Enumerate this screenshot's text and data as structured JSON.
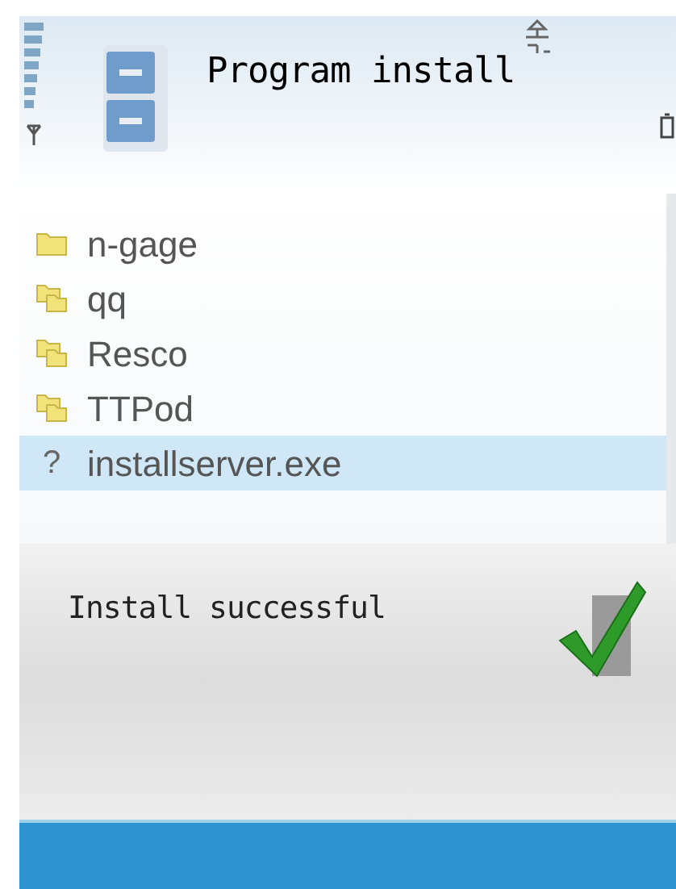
{
  "title": "Program install",
  "items": [
    {
      "name": "n-gage",
      "kind": "folder",
      "selected": false
    },
    {
      "name": "qq",
      "kind": "folder-group",
      "selected": false
    },
    {
      "name": "Resco",
      "kind": "folder-group",
      "selected": false
    },
    {
      "name": "TTPod",
      "kind": "folder-group",
      "selected": false
    },
    {
      "name": "installserver.exe",
      "kind": "unknown",
      "icon": "?",
      "selected": true
    }
  ],
  "dialog": {
    "message": "Install successful"
  }
}
